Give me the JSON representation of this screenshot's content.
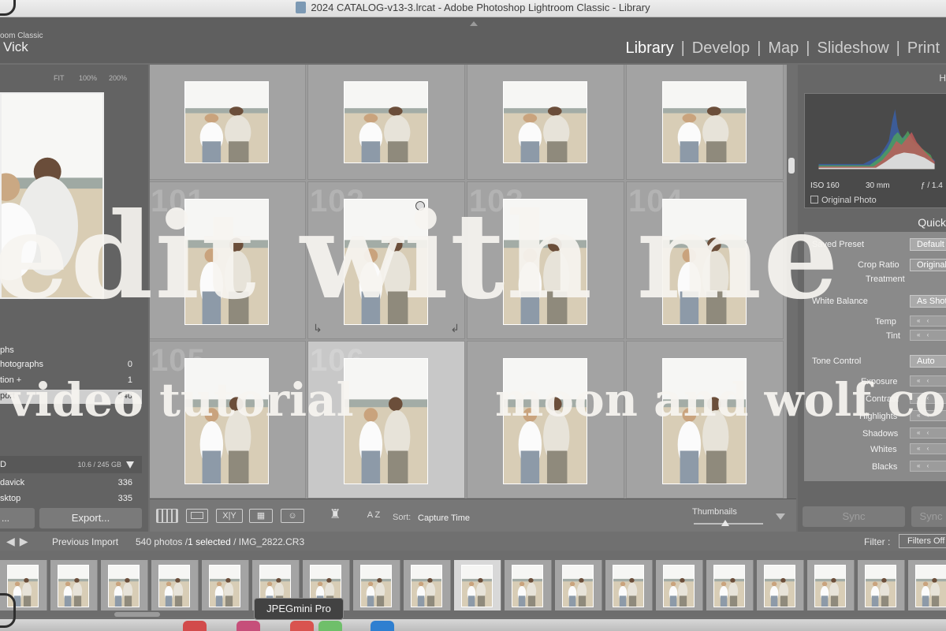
{
  "window": {
    "title": "2024 CATALOG-v13-3.lrcat - Adobe Photoshop Lightroom Classic - Library",
    "file_icon": "LRC AT"
  },
  "identity": {
    "app_label": "oom Classic",
    "user_name": "Vick"
  },
  "modules": [
    "Library",
    "Develop",
    "Map",
    "Slideshow",
    "Print"
  ],
  "active_module": "Library",
  "navigator": {
    "zoom_options": [
      "FIT",
      "100%",
      "200%"
    ]
  },
  "left_panel": {
    "catalog_rows": [
      {
        "label": "phs",
        "count": ""
      },
      {
        "label": "hotographs",
        "count": "0"
      },
      {
        "label": "tion +",
        "count": "1"
      },
      {
        "label": "port",
        "count": "540",
        "selected": true
      }
    ],
    "volume": {
      "label": "D",
      "size": "10.6 / 245 GB"
    },
    "folders": [
      {
        "label": "davick",
        "count": "336"
      },
      {
        "label": "sktop",
        "count": "335"
      }
    ],
    "import_label": "...",
    "export_label": "Export..."
  },
  "grid": {
    "row_numbers": [
      "101",
      "102",
      "103",
      "104",
      "105",
      "106"
    ],
    "selected_index": 9
  },
  "toolbar": {
    "sort_label": "Sort:",
    "sort_value": "Capture Time",
    "thumbnails_label": "Thumbnails",
    "thumbnails_level": 0.45,
    "view_icons": [
      "grid-view-icon",
      "loupe-view-icon",
      "compare-view-icon",
      "survey-view-icon",
      "people-view-icon",
      "spray-can-icon",
      "sort-direction-icon"
    ],
    "compare_glyph": "X|Y",
    "sort_glyph": "A Z"
  },
  "right_panel": {
    "histogram_label": "H",
    "iso": "ISO 160",
    "focal": "30 mm",
    "aperture": "ƒ / 1.4",
    "original_photo": "Original Photo",
    "quick_develop_title": "Quick",
    "saved_preset_label": "Saved Preset",
    "saved_preset_value": "Default S",
    "crop_ratio_label": "Crop Ratio",
    "crop_ratio_value": "Original",
    "treatment_label": "Treatment",
    "white_balance_label": "White Balance",
    "white_balance_value": "As Shot",
    "temp_label": "Temp",
    "tint_label": "Tint",
    "tone_control_label": "Tone Control",
    "tone_control_value": "Auto",
    "exposure_label": "Exposure",
    "contrast_label": "Contrast",
    "highlights_label": "Highlights",
    "shadows_label": "Shadows",
    "whites_label": "Whites",
    "blacks_label": "Blacks",
    "stepper_glyph": "« ‹",
    "sync_label": "Sync",
    "sync_settings_label": "Sync"
  },
  "filmstrip_bar": {
    "source": "Previous Import",
    "count": "540 photos /",
    "selected": "1 selected",
    "filename": "/ IMG_2822.CR3",
    "filter_label": "Filter :",
    "filter_value": "Filters Off"
  },
  "filmstrip": {
    "selected_index": 9
  },
  "dock": {
    "tooltip": "JPEGmini Pro"
  },
  "overlay": {
    "headline": "edit with me",
    "left_sub": "video tutorial",
    "right_sub": "moon and wolf co"
  },
  "colors": {
    "accent": "#ffffff",
    "panel": "#6f6f6f",
    "grid_bg": "#9c9c9c",
    "overlay_text": "#f6f4f0"
  }
}
